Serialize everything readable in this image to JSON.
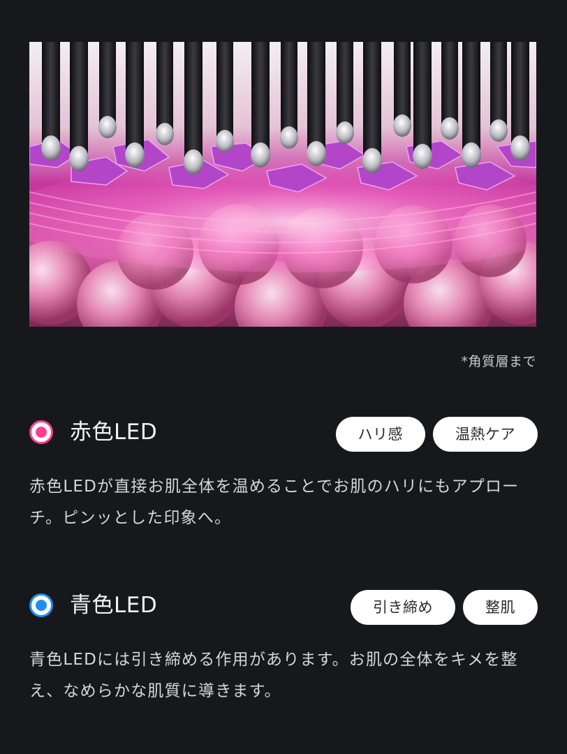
{
  "hero": {
    "image_description_icon": "led-skin-illustration-icon",
    "caption": "*角質層まで"
  },
  "red_led": {
    "title": "赤色LED",
    "color": "#ff3f93",
    "tags": [
      "ハリ感",
      "温熱ケア"
    ],
    "description": "赤色LEDが直接お肌全体を温めることでお肌のハリにもアプローチ。ピンッとした印象へ。"
  },
  "blue_led": {
    "title": "青色LED",
    "color": "#1e8ff0",
    "tags": [
      "引き締め",
      "整肌"
    ],
    "description": "青色LEDには引き締める作用があります。お肌の全体をキメを整え、なめらかな肌質に導きます。"
  }
}
